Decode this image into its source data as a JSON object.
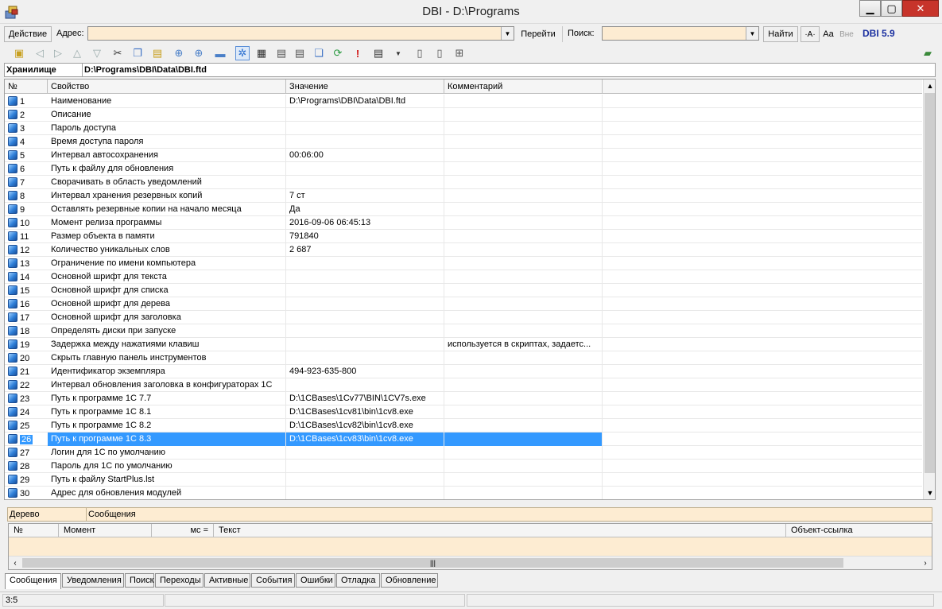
{
  "window": {
    "title": "DBI - D:\\Programs"
  },
  "addressbar": {
    "action_label": "Действие",
    "address_label": "Адрес:",
    "address_value": "",
    "go_label": "Перейти",
    "search_label": "Поиск:",
    "search_value": "",
    "find_label": "Найти",
    "match_word_label": "·A·",
    "match_case_label": "Aa",
    "outside_label": "Вне",
    "version": "DBI 5.9"
  },
  "storage": {
    "label": "Хранилище",
    "path": "D:\\Programs\\DBI\\Data\\DBI.ftd"
  },
  "grid": {
    "columns": [
      "№",
      "Свойство",
      "Значение",
      "Комментарий"
    ],
    "rows": [
      {
        "n": "1",
        "prop": "Наименование",
        "val": "D:\\Programs\\DBI\\Data\\DBI.ftd",
        "cm": ""
      },
      {
        "n": "2",
        "prop": "Описание",
        "val": "",
        "cm": ""
      },
      {
        "n": "3",
        "prop": "Пароль доступа",
        "val": "",
        "cm": ""
      },
      {
        "n": "4",
        "prop": "Время доступа пароля",
        "val": "",
        "cm": ""
      },
      {
        "n": "5",
        "prop": "Интервал автосохранения",
        "val": "00:06:00",
        "cm": ""
      },
      {
        "n": "6",
        "prop": "Путь к файлу для обновления",
        "val": "",
        "cm": ""
      },
      {
        "n": "7",
        "prop": "Сворачивать в область уведомлений",
        "val": "",
        "cm": ""
      },
      {
        "n": "8",
        "prop": "Интервал хранения резервных копий",
        "val": "7 ст",
        "cm": ""
      },
      {
        "n": "9",
        "prop": "Оставлять резервные копии на начало месяца",
        "val": "Да",
        "cm": ""
      },
      {
        "n": "10",
        "prop": "Момент релиза программы",
        "val": "2016-09-06 06:45:13",
        "cm": ""
      },
      {
        "n": "11",
        "prop": "Размер объекта в памяти",
        "val": "791840",
        "cm": ""
      },
      {
        "n": "12",
        "prop": "Количество уникальных слов",
        "val": "2 687",
        "cm": ""
      },
      {
        "n": "13",
        "prop": "Ограничение по имени компьютера",
        "val": "",
        "cm": ""
      },
      {
        "n": "14",
        "prop": "Основной шрифт для текста",
        "val": "",
        "cm": ""
      },
      {
        "n": "15",
        "prop": "Основной шрифт для списка",
        "val": "",
        "cm": ""
      },
      {
        "n": "16",
        "prop": "Основной шрифт для дерева",
        "val": "",
        "cm": ""
      },
      {
        "n": "17",
        "prop": "Основной шрифт для заголовка",
        "val": "",
        "cm": ""
      },
      {
        "n": "18",
        "prop": "Определять диски при запуске",
        "val": "",
        "cm": ""
      },
      {
        "n": "19",
        "prop": "Задержка между нажатиями клавиш",
        "val": "",
        "cm": "используется в скриптах, задаетс..."
      },
      {
        "n": "20",
        "prop": "Скрыть главную панель инструментов",
        "val": "",
        "cm": ""
      },
      {
        "n": "21",
        "prop": "Идентификатор экземпляра",
        "val": "494-923-635-800",
        "cm": ""
      },
      {
        "n": "22",
        "prop": "Интервал обновления заголовка в конфигураторах 1С",
        "val": "",
        "cm": ""
      },
      {
        "n": "23",
        "prop": "Путь к программе 1С 7.7",
        "val": "D:\\1CBases\\1Cv77\\BIN\\1CV7s.exe",
        "cm": ""
      },
      {
        "n": "24",
        "prop": "Путь к программе 1С 8.1",
        "val": "D:\\1CBases\\1cv81\\bin\\1cv8.exe",
        "cm": ""
      },
      {
        "n": "25",
        "prop": "Путь к программе 1С 8.2",
        "val": "D:\\1CBases\\1cv82\\bin\\1cv8.exe",
        "cm": ""
      },
      {
        "n": "26",
        "prop": "Путь к программе 1С 8.3",
        "val": "D:\\1CBases\\1cv83\\bin\\1cv8.exe",
        "cm": "",
        "selected": true
      },
      {
        "n": "27",
        "prop": "Логин для 1С по умолчанию",
        "val": "",
        "cm": ""
      },
      {
        "n": "28",
        "prop": "Пароль для 1С по умолчанию",
        "val": "",
        "cm": ""
      },
      {
        "n": "29",
        "prop": "Путь к файлу StartPlus.lst",
        "val": "",
        "cm": ""
      },
      {
        "n": "30",
        "prop": "Адрес для обновления модулей",
        "val": "",
        "cm": ""
      }
    ]
  },
  "lower_panel": {
    "tree_label": "Дерево",
    "messages_label": "Сообщения",
    "columns": [
      "№",
      "Момент",
      "мс =",
      "Текст",
      "Объект-ссылка"
    ]
  },
  "bottom_tabs": [
    "Сообщения",
    "Уведомления",
    "Поиск",
    "Переходы",
    "Активные",
    "События",
    "Ошибки",
    "Отладка",
    "Обновление"
  ],
  "statusbar": {
    "position": "3:5"
  },
  "icons": {
    "app": "app-icon",
    "minimize": "minimize-icon",
    "maximize": "maximize-icon",
    "close": "close-icon",
    "row": "property-cube-icon"
  },
  "colors": {
    "accent_selection": "#3399ff",
    "input_bg": "#fdecd2",
    "version_text": "#1a2fa0",
    "close_btn": "#c7342b"
  }
}
